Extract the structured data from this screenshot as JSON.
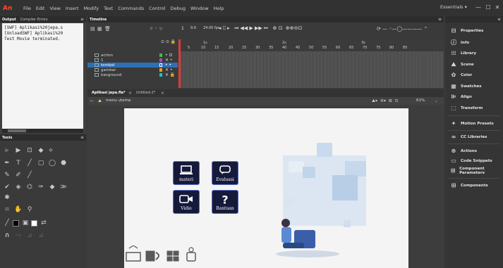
{
  "app": {
    "logo": "An",
    "menu": [
      "File",
      "Edit",
      "View",
      "Insert",
      "Modify",
      "Text",
      "Commands",
      "Control",
      "Debug",
      "Window",
      "Help"
    ],
    "workspace": "Essentials ▾",
    "window_controls": [
      "—",
      "☐",
      "✕"
    ]
  },
  "output_panel": {
    "tabs": [
      "Output",
      "Compiler Errors"
    ],
    "lines": [
      "[SWF] Aplikasi%20jepa.s",
      "[UnloadSWF] Aplikasi%20",
      "Test Movie terminated."
    ]
  },
  "tools_panel": {
    "title": "Tools"
  },
  "timeline": {
    "title": "Timeline",
    "fps": "9.0",
    "fps_unit": "24.00 fps",
    "frame_numbers": [
      "5",
      "10",
      "15",
      "20",
      "25",
      "30",
      "35",
      "40",
      "45",
      "50",
      "55",
      "60",
      "65",
      "70",
      "75",
      "80",
      "85"
    ],
    "seconds": [
      "1s",
      "2s",
      "3s"
    ],
    "layers": [
      {
        "name": "action",
        "color": "#38c238",
        "selected": false
      },
      {
        "name": "1",
        "color": "#c040c0",
        "selected": false
      },
      {
        "name": "tombol",
        "color": "#2060d0",
        "selected": true
      },
      {
        "name": "gambar",
        "color": "#e0a020",
        "selected": false
      },
      {
        "name": "bacground",
        "color": "#20c0c0",
        "selected": false
      }
    ]
  },
  "document": {
    "tabs": [
      "Aplikasi jepa.fla*",
      "Untitled-2*"
    ],
    "scene": "menu utama",
    "zoom": "61%"
  },
  "stage": {
    "buttons": [
      {
        "label": "materi",
        "icon": "laptop-icon"
      },
      {
        "label": "Evaluasi",
        "icon": "chat-bubble-icon"
      },
      {
        "label": "Vidio",
        "icon": "video-camera-icon"
      },
      {
        "label": "Bantuan",
        "icon": "question-mark-icon"
      }
    ]
  },
  "right_panel": {
    "items": [
      "Properties",
      "Info",
      "Library",
      "Scene",
      "Color",
      "Swatches",
      "Align",
      "Transform",
      "Motion Presets",
      "CC Libraries",
      "Actions",
      "Code Snippets",
      "Component Parameters",
      "Components"
    ]
  },
  "colors": {
    "selection": "#2f6fb4",
    "playhead": "#e03a3a",
    "button_fill": "#161a3a",
    "button_border": "#5870c8"
  }
}
